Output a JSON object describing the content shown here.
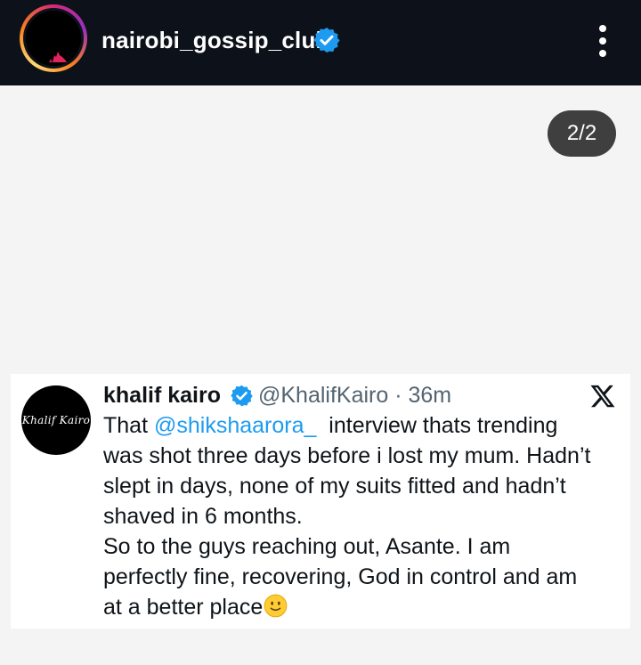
{
  "header": {
    "username": "nairobi_gossip_club",
    "avatar_icon": "avatar-image",
    "verified_icon": "verified-badge-icon",
    "more_icon": "more-options-icon"
  },
  "slide_counter": "2/2",
  "tweet": {
    "avatar_text": "Khalif Kairo",
    "display_name": "khalif kairo",
    "handle": "@KhalifKairo",
    "separator": " · ",
    "time": "36m",
    "body": {
      "line_1_prefix": "That ",
      "mention": "@shikshaarora_",
      "line_1_suffix": "  interview thats trending",
      "line_2": "was shot three days before i lost my mum. Hadn’t",
      "line_3": "slept in days, none of my suits fitted and hadn’t",
      "line_4": "shaved in 6 months.",
      "line_5": "So to the guys reaching out, Asante. I am",
      "line_6": "perfectly fine, recovering, God in control and am",
      "line_7": "at a better place"
    },
    "emoji": "slightly-smiling-face-icon",
    "platform_icon": "x-logo-icon"
  },
  "colors": {
    "header_bg": "#0d121a",
    "verified_blue": "#1d9bf0",
    "mention_blue": "#1d9bf0",
    "counter_bg": "#3f3f3f"
  }
}
